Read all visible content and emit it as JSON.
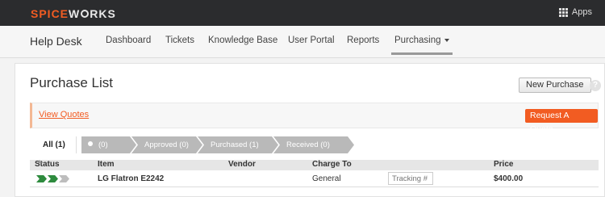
{
  "topbar": {
    "logo_part1": "SPICE",
    "logo_part2": "W",
    "logo_part3": "RKS",
    "apps_label": "Apps",
    "apps_icon": "grid-icon"
  },
  "nav": {
    "title": "Help Desk",
    "items": [
      {
        "label": "Dashboard"
      },
      {
        "label": "Tickets"
      },
      {
        "label": "Knowledge Base"
      },
      {
        "label": "User Portal"
      },
      {
        "label": "Reports"
      },
      {
        "label": "Purchasing"
      }
    ]
  },
  "page": {
    "title": "Purchase List",
    "new_button": "New Purchase",
    "help_label": "?",
    "view_quotes": "View Quotes",
    "request_quote": "Request A Quote"
  },
  "filters": {
    "all_label": "All (1)",
    "steps": [
      {
        "label": "(0)"
      },
      {
        "label": "Approved (0)"
      },
      {
        "label": "Purchased (1)"
      },
      {
        "label": "Received (0)"
      }
    ]
  },
  "table": {
    "columns": [
      "Status",
      "Item",
      "Vendor",
      "Charge To",
      "Price"
    ],
    "rows": [
      {
        "item": "LG Flatron E2242",
        "vendor": "",
        "charge_to": "General",
        "tracking_placeholder": "Tracking #",
        "price": "$400.00"
      }
    ]
  },
  "colors": {
    "brand": "#f25c22",
    "status_done": "#2e8b3e",
    "status_pending": "#bdbdbd"
  }
}
